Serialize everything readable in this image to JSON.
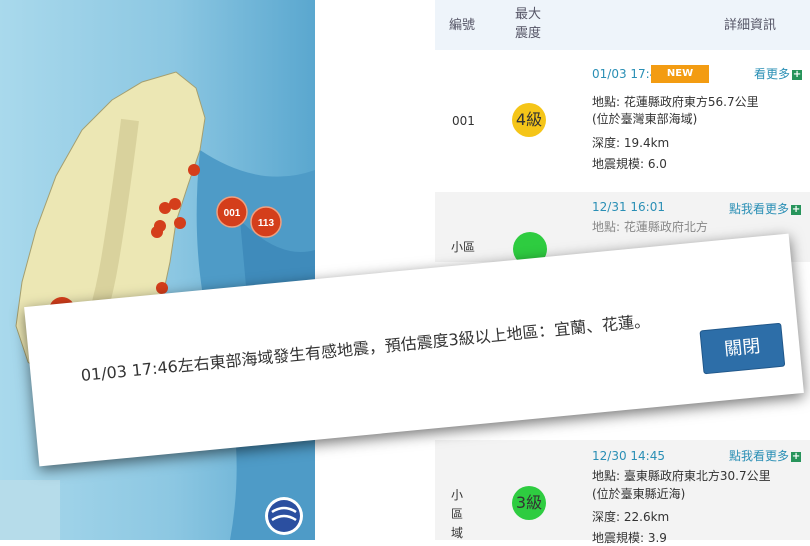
{
  "map": {
    "markers": [
      {
        "id": "001",
        "color": "#d43e1b"
      },
      {
        "id": "113",
        "color": "#d43e1b"
      }
    ]
  },
  "table": {
    "headers": {
      "id": "編號",
      "max_intensity": "最大\n震度",
      "details": "詳細資訊"
    },
    "rows": [
      {
        "id": "001",
        "intensity": "4級",
        "intensity_color": "#f5c518",
        "time": "01/03 17:46",
        "new_badge": "NEW",
        "more": "看更多",
        "location": "地點: 花蓮縣政府東方56.7公里",
        "location_detail": "(位於臺灣東部海域)",
        "depth": "深度: 19.4km",
        "magnitude": "地震規模: 6.0"
      },
      {
        "time": "12/31 16:01",
        "more": "點我看更多",
        "location": "地點: 花蓮縣政府北方",
        "id_partial": "小區",
        "intensity_color": "#2ecc40"
      },
      {
        "id": "小區域",
        "intensity": "3級",
        "intensity_color": "#2ecc40",
        "time": "12/30 14:45",
        "more": "點我看更多",
        "location": "地點: 臺東縣政府東北方30.7公里",
        "location_detail": "(位於臺東縣近海)",
        "depth": "深度: 22.6km",
        "magnitude": "地震規模: 3.9"
      }
    ]
  },
  "modal": {
    "message": "01/03 17:46左右東部海域發生有感地震，預估震度3級以上地區：宜蘭、花蓮。",
    "close_label": "關閉"
  }
}
